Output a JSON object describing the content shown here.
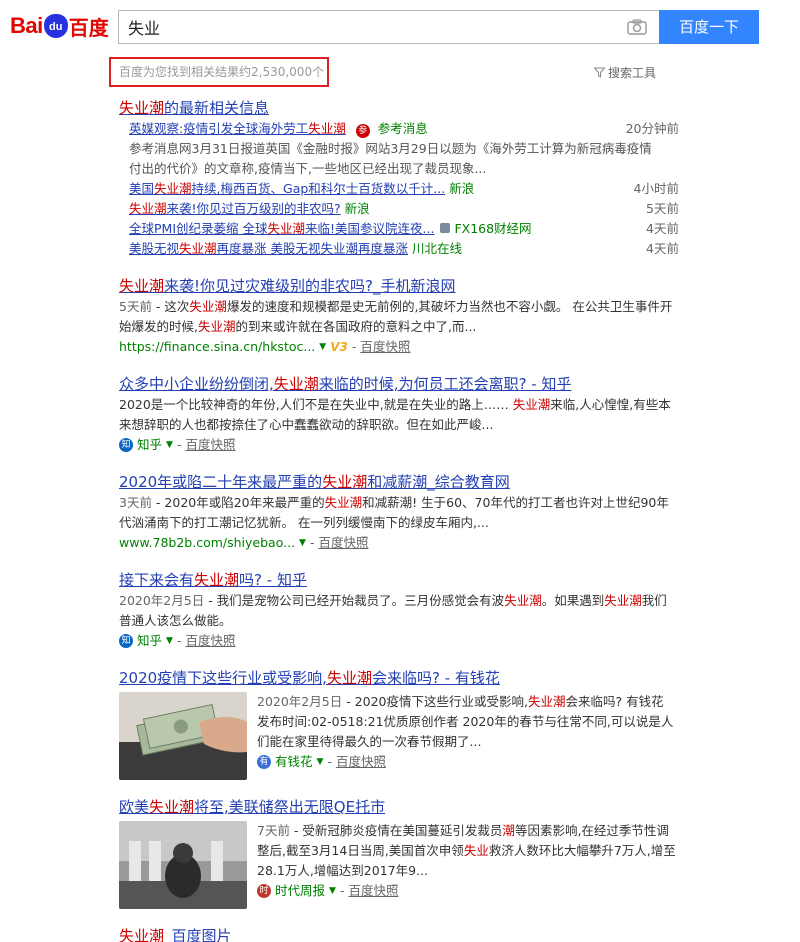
{
  "header": {
    "logo_latin": "Bai",
    "logo_paw": "du",
    "logo_cn": "百度",
    "search_value": "失业",
    "search_button": "百度一下"
  },
  "stats": {
    "text": "百度为您找到相关结果约2,530,000个",
    "tools_label": "搜索工具"
  },
  "news_block": {
    "title_pre": "",
    "title_em": "失业潮",
    "title_post": "的最新相关信息",
    "top": {
      "link_pre": "英媒观察:疫情引发全球海外劳工",
      "link_em": "失业潮",
      "source": "参考消息",
      "time": "20分钟前",
      "abstract": "参考消息网3月31日报道英国《金融时报》网站3月29日以题为《海外劳工计算为新冠病毒疫情付出的代价》的文章称,疫情当下,一些地区已经出现了裁员现象..."
    },
    "items": [
      {
        "pre": "美国",
        "em": "失业潮",
        "post": "持续,梅西百货、Gap和科尔士百货数以千计...",
        "source": "新浪",
        "time": "4小时前"
      },
      {
        "pre": "",
        "em": "失业潮",
        "post": "来袭!你见过百万级别的非农吗?",
        "source": "新浪",
        "time": "5天前"
      },
      {
        "pre": "全球PMI创纪录萎缩 全球",
        "em": "失业潮",
        "post": "来临!美国参议院连夜...",
        "source": "FX168财经网",
        "time": "4天前"
      },
      {
        "pre": "美股无视",
        "em": "失业潮",
        "post": "再度暴涨 美股无视失业潮再度暴涨",
        "source": "川北在线",
        "time": "4天前"
      }
    ]
  },
  "results": [
    {
      "title_pre": "",
      "title_em": "失业潮",
      "title_post": "来袭!你见过灾难级别的非农吗?_手机新浪网",
      "date": "5天前",
      "abs_pre": " - 这次",
      "abs_em": "失业潮",
      "abs_mid": "爆发的速度和规模都是史无前例的,其破坏力当然也不容小觑。 在公共卫生事件开始爆发的时候,",
      "abs_em2": "失业潮",
      "abs_post": "的到来或许就在各国政府的意料之中了,而...",
      "url": "https://finance.sina.cn/hkstoc...",
      "badge": "V3",
      "snapshot": "百度快照"
    },
    {
      "title_pre": "众多中小企业纷纷倒闭,",
      "title_em": "失业潮",
      "title_post": "来临的时候,为何员工还会离职? - 知乎",
      "date": "",
      "abs_pre": "2020是一个比较神奇的年份,人们不是在失业中,就是在失业的路上…… ",
      "abs_em": "失业潮",
      "abs_mid": "来临,人心惶惶,有些本来想辞职的人也都按捺住了心中蠢蠢欲动的辞职欲。但在如此严峻...",
      "abs_em2": "",
      "abs_post": "",
      "url": "知乎",
      "snapshot": "百度快照"
    },
    {
      "title_pre": "2020年或陷二十年来最严重的",
      "title_em": "失业潮",
      "title_post": "和减薪潮_综合教育网",
      "date": "3天前",
      "abs_pre": " - 2020年或陷20年来最严重的",
      "abs_em": "失业潮",
      "abs_mid": "和减薪潮! 生于60、70年代的打工者也许对上世纪90年代汹涌南下的打工潮记忆犹新。 在一列列缓慢南下的绿皮车厢内,...",
      "abs_em2": "",
      "abs_post": "",
      "url": "www.78b2b.com/shiyebao...",
      "snapshot": "百度快照"
    },
    {
      "title_pre": "接下来会有",
      "title_em": "失业潮",
      "title_post": "吗? - 知乎",
      "date": "2020年2月5日",
      "abs_pre": " - 我们是宠物公司已经开始裁员了。三月份感觉会有波",
      "abs_em": "失业潮",
      "abs_mid": "。如果遇到",
      "abs_em2": "失业潮",
      "abs_post": "我们普通人该怎么做能。",
      "url": "知乎",
      "snapshot": "百度快照"
    },
    {
      "title_pre": "2020疫情下这些行业或受影响,",
      "title_em": "失业潮",
      "title_post": "会来临吗? - 有钱花",
      "date": "2020年2月5日",
      "abs_pre": " - 2020疫情下这些行业或受影响,",
      "abs_em": "失业潮",
      "abs_mid": "会来临吗? 有钱花 发布时间:02-0518:21优质原创作者 2020年的春节与往常不同,可以说是人们能在家里待得最久的一次春节假期了...",
      "abs_em2": "",
      "abs_post": "",
      "url": "有钱花",
      "snapshot": "百度快照"
    },
    {
      "title_pre": "欧美",
      "title_em": "失业潮",
      "title_post": "将至,美联储祭出无限QE托市",
      "date": "7天前",
      "abs_pre": " - 受新冠肺炎疫情在美国蔓延引发裁员",
      "abs_em": "潮",
      "abs_mid": "等因素影响,在经过季节性调整后,截至3月14日当周,美国首次申领",
      "abs_em2": "失业",
      "abs_post": "救济人数环比大幅攀升7万人,增至28.1万人,增幅达到2017年9...",
      "url": "时代周报",
      "snapshot": "百度快照"
    },
    {
      "title_pre": "",
      "title_em": "失业潮",
      "title_post": "_百度图片"
    }
  ]
}
